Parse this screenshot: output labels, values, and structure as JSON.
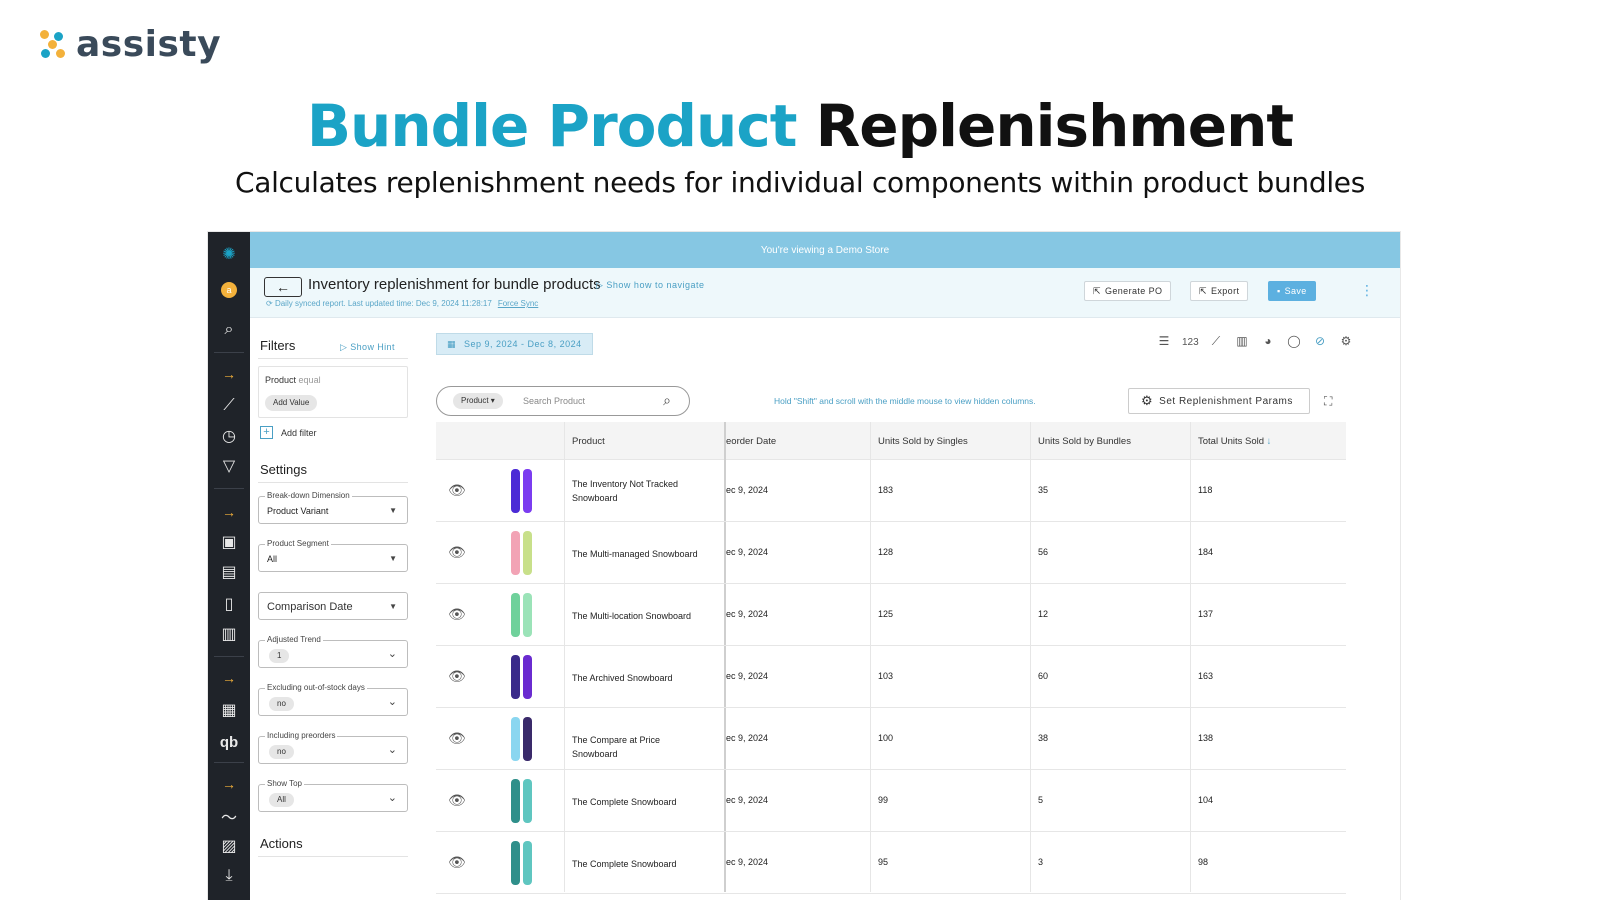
{
  "brand": {
    "name": "assisty",
    "accent": "#1ba3c6"
  },
  "headline": {
    "accent": "Bundle Product",
    "plain": "Replenishment"
  },
  "subheadline": "Calculates replenishment needs for individual components within product bundles",
  "app": {
    "banner": "You're viewing a Demo Store",
    "title": "Inventory replenishment for bundle products",
    "nav_hint": "Show how to navigate",
    "sync_text": "Daily synced report. Last updated time: Dec 9, 2024 11:28:17",
    "force_sync": "Force Sync",
    "buttons": {
      "generate_po": "Generate PO",
      "export": "Export",
      "save": "Save"
    },
    "filters": {
      "title": "Filters",
      "show_hint": "Show Hint",
      "product_label": "Product",
      "product_op": "equal",
      "add_value": "Add Value",
      "add_filter": "Add filter"
    },
    "settings": {
      "title": "Settings",
      "breakdown_label": "Break-down Dimension",
      "breakdown_value": "Product Variant",
      "segment_label": "Product Segment",
      "segment_value": "All",
      "comparison_value": "Comparison Date",
      "trend_label": "Adjusted Trend",
      "trend_value": "1",
      "oos_label": "Excluding out-of-stock days",
      "oos_value": "no",
      "preorders_label": "Including preorders",
      "preorders_value": "no",
      "showtop_label": "Show Top",
      "showtop_value": "All"
    },
    "actions_title": "Actions",
    "date_range": "Sep 9, 2024 - Dec 8, 2024",
    "search": {
      "chip": "Product",
      "placeholder": "Search Product"
    },
    "shift_hint": "Hold \"Shift\" and scroll with the middle mouse to view hidden columns.",
    "set_params": "Set Replenishment Params",
    "columns": {
      "product": "Product",
      "reorder_date": "eorder Date",
      "singles": "Units Sold by Singles",
      "bundles": "Units Sold by Bundles",
      "total": "Total Units Sold"
    },
    "rows": [
      {
        "name": "The Inventory Not Tracked Snowboard",
        "date": "ec 9, 2024",
        "singles": "183",
        "bundles": "35",
        "total": "118",
        "c1": "#4b2bd6",
        "c2": "#7b3cf0"
      },
      {
        "name": "The Multi-managed Snowboard",
        "date": "ec 9, 2024",
        "singles": "128",
        "bundles": "56",
        "total": "184",
        "c1": "#f2a3b5",
        "c2": "#c8e08a"
      },
      {
        "name": "The Multi-location Snowboard",
        "date": "ec 9, 2024",
        "singles": "125",
        "bundles": "12",
        "total": "137",
        "c1": "#6fd19b",
        "c2": "#9be3b8"
      },
      {
        "name": "The Archived Snowboard",
        "date": "ec 9, 2024",
        "singles": "103",
        "bundles": "60",
        "total": "163",
        "c1": "#3a2a8a",
        "c2": "#6a2bd0"
      },
      {
        "name": "The Compare at Price Snowboard",
        "date": "ec 9, 2024",
        "singles": "100",
        "bundles": "38",
        "total": "138",
        "c1": "#8ad6f0",
        "c2": "#3a2a6a"
      },
      {
        "name": "The Complete Snowboard",
        "date": "ec 9, 2024",
        "singles": "99",
        "bundles": "5",
        "total": "104",
        "c1": "#2f8f8a",
        "c2": "#5fc6c0"
      },
      {
        "name": "The Complete Snowboard",
        "date": "ec 9, 2024",
        "singles": "95",
        "bundles": "3",
        "total": "98",
        "c1": "#2f8f8a",
        "c2": "#5fc6c0"
      }
    ]
  }
}
